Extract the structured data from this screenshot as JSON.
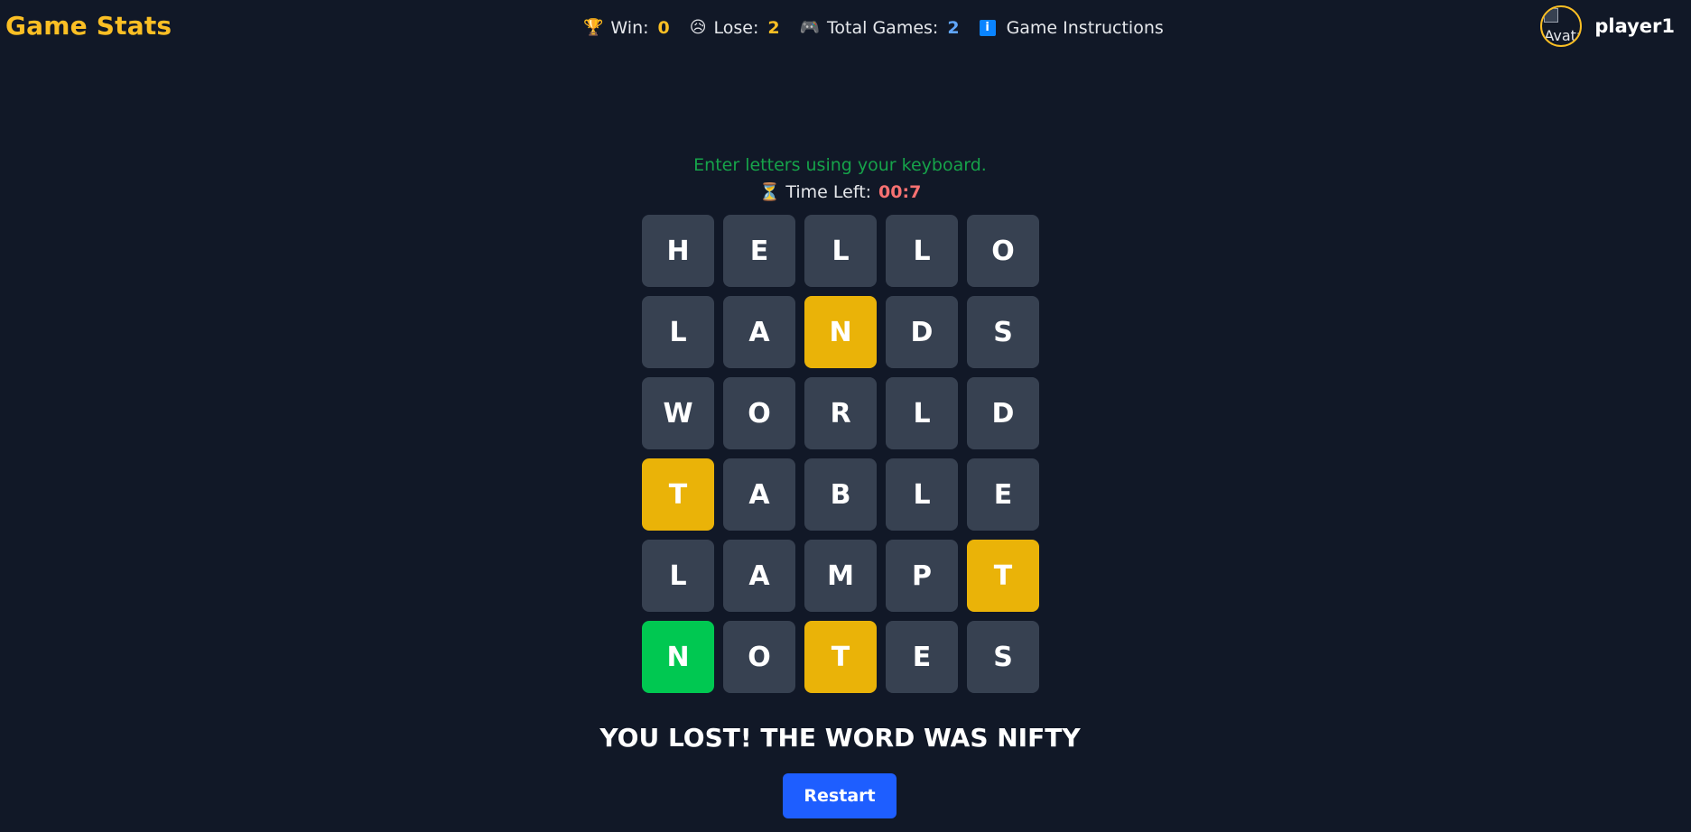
{
  "header": {
    "brand": "Game Stats",
    "stats": {
      "win": {
        "icon": "trophy-icon",
        "label": "Win:",
        "value": "0"
      },
      "lose": {
        "icon": "sad-face-icon",
        "label": "Lose:",
        "value": "2"
      },
      "total": {
        "icon": "game-controller-icon",
        "label": "Total Games:",
        "value": "2"
      }
    },
    "instructions": {
      "icon": "info-icon",
      "label": "Game Instructions"
    },
    "user": {
      "avatar_alt": "Avatar",
      "name": "player1"
    }
  },
  "game": {
    "hint": "Enter letters using your keyboard.",
    "timer": {
      "icon": "hourglass-icon",
      "label": "Time Left:",
      "value": "00:7"
    },
    "board": [
      [
        {
          "l": "H",
          "s": "absent"
        },
        {
          "l": "E",
          "s": "absent"
        },
        {
          "l": "L",
          "s": "absent"
        },
        {
          "l": "L",
          "s": "absent"
        },
        {
          "l": "O",
          "s": "absent"
        }
      ],
      [
        {
          "l": "L",
          "s": "absent"
        },
        {
          "l": "A",
          "s": "absent"
        },
        {
          "l": "N",
          "s": "present"
        },
        {
          "l": "D",
          "s": "absent"
        },
        {
          "l": "S",
          "s": "absent"
        }
      ],
      [
        {
          "l": "W",
          "s": "absent"
        },
        {
          "l": "O",
          "s": "absent"
        },
        {
          "l": "R",
          "s": "absent"
        },
        {
          "l": "L",
          "s": "absent"
        },
        {
          "l": "D",
          "s": "absent"
        }
      ],
      [
        {
          "l": "T",
          "s": "present"
        },
        {
          "l": "A",
          "s": "absent"
        },
        {
          "l": "B",
          "s": "absent"
        },
        {
          "l": "L",
          "s": "absent"
        },
        {
          "l": "E",
          "s": "absent"
        }
      ],
      [
        {
          "l": "L",
          "s": "absent"
        },
        {
          "l": "A",
          "s": "absent"
        },
        {
          "l": "M",
          "s": "absent"
        },
        {
          "l": "P",
          "s": "absent"
        },
        {
          "l": "T",
          "s": "present"
        }
      ],
      [
        {
          "l": "N",
          "s": "correct"
        },
        {
          "l": "O",
          "s": "absent"
        },
        {
          "l": "T",
          "s": "present"
        },
        {
          "l": "E",
          "s": "absent"
        },
        {
          "l": "S",
          "s": "absent"
        }
      ]
    ],
    "result": "YOU LOST! THE WORD WAS NIFTY",
    "restart_label": "Restart"
  },
  "colors": {
    "background": "#111827",
    "tile_absent": "#374151",
    "tile_present": "#eab308",
    "tile_correct": "#00c851",
    "accent_gold": "#fbbf24",
    "button_blue": "#1e5eff"
  }
}
